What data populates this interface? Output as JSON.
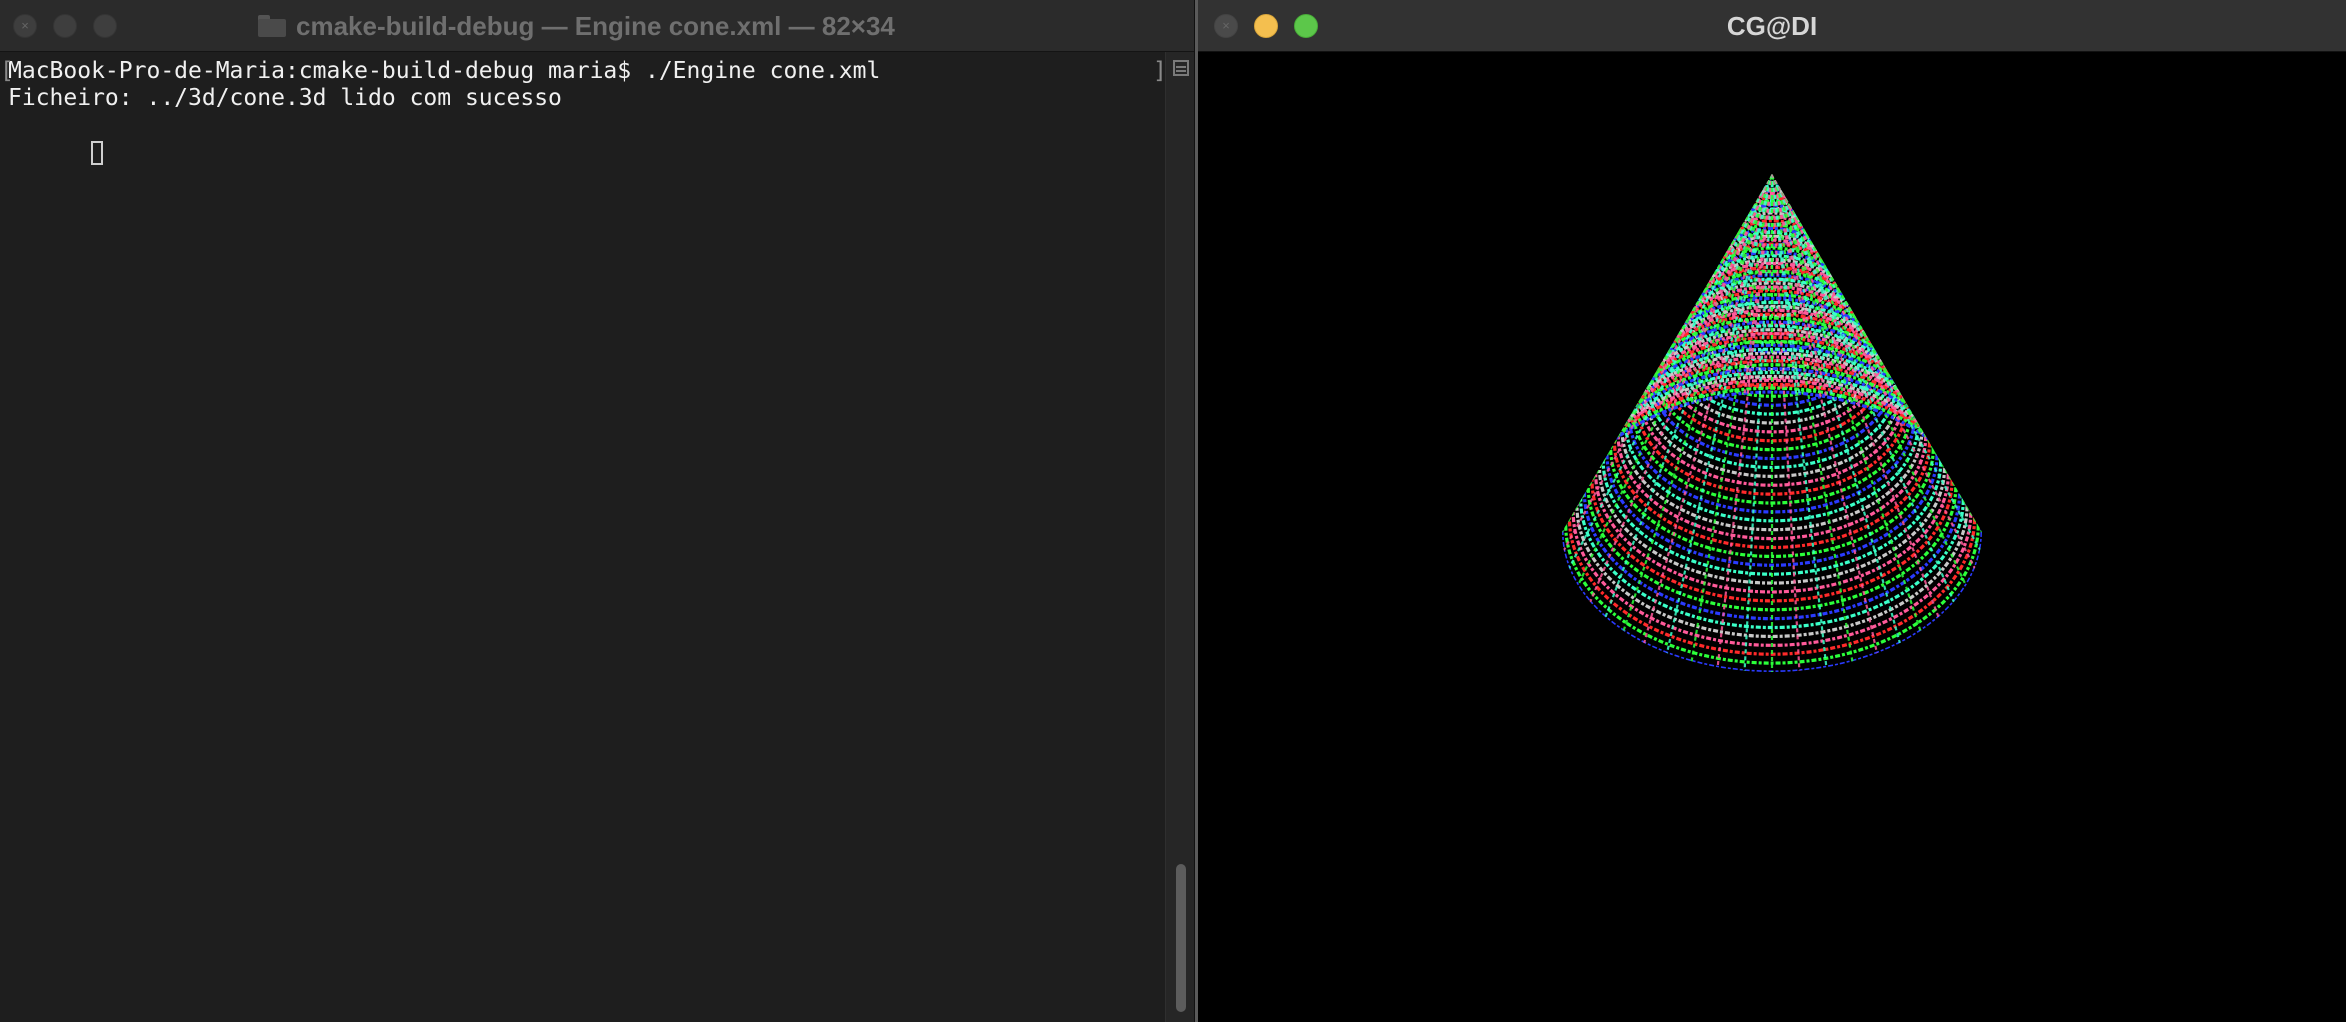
{
  "terminal": {
    "title": "cmake-build-debug — Engine cone.xml — 82×34",
    "lines": [
      "MacBook-Pro-de-Maria:cmake-build-debug maria$ ./Engine cone.xml",
      "Ficheiro: ../3d/cone.3d lido com sucesso"
    ],
    "bracket_left": "[",
    "bracket_right": "]"
  },
  "gl_window": {
    "title": "CG@DI",
    "render_colors": [
      "#ff2a2a",
      "#2bff3a",
      "#2a3bff",
      "#3affc8",
      "#c8c8c8",
      "#ff5a9a"
    ],
    "background_color": "#000000"
  }
}
